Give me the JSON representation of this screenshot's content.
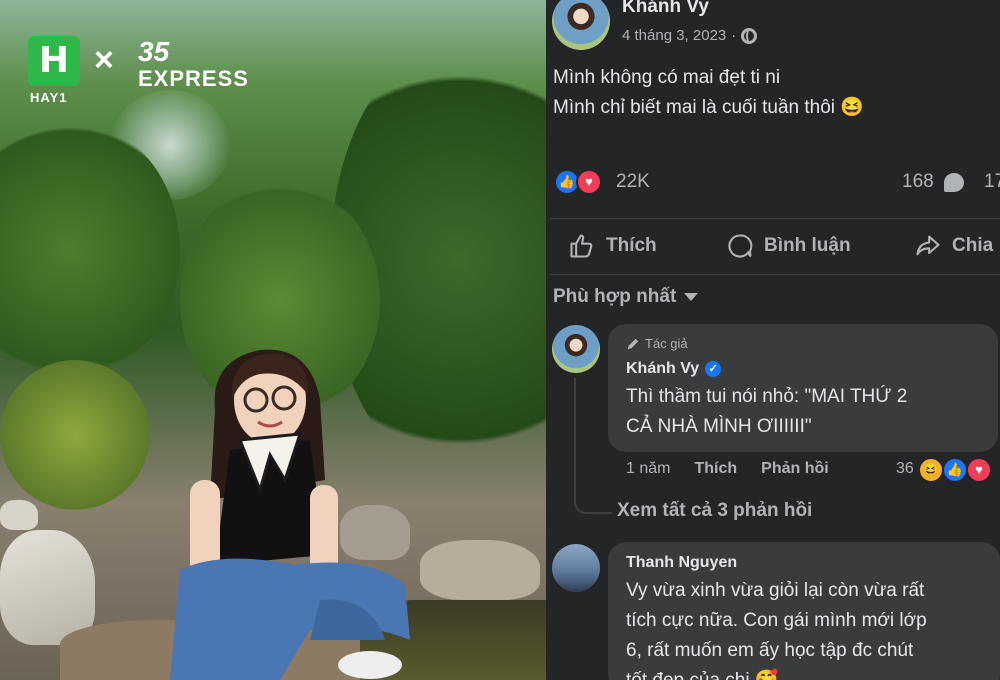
{
  "brand": {
    "logo_letter": "H",
    "logo_caption": "HAY1",
    "separator": "×",
    "partner_number": "35",
    "partner_word": "EXPRESS"
  },
  "post": {
    "author": "Khánh Vy",
    "date": "4 tháng 3, 2023",
    "separator_dot": "·",
    "lines": [
      "Mình không có mai đẹt ti ni",
      "Mình chỉ biết mai là cuối tuần thôi 😆"
    ],
    "reaction_count": "22K",
    "comment_count": "168",
    "share_count_partial": "17"
  },
  "actions": {
    "like": "Thích",
    "comment": "Bình luận",
    "share": "Chia"
  },
  "sort_label": "Phù hợp nhất",
  "comments": [
    {
      "badge": "Tác giả",
      "name": "Khánh Vy",
      "lines": [
        "Thì thầm tui nói nhỏ: \"MAI THỨ 2",
        "CẢ NHÀ MÌNH ƠIIIIII\""
      ],
      "time": "1 năm",
      "like_label": "Thích",
      "reply_label": "Phản hồi",
      "reaction_count": "36"
    },
    {
      "name": "Thanh Nguyen",
      "lines": [
        "Vy vừa xinh vừa giỏi lại còn vừa rất",
        "tích cực nữa. Con gái mình mới lớp",
        "6, rất muốn em ấy học tập đc chút",
        "tốt đẹp của chị 🥰"
      ]
    }
  ],
  "view_replies": "Xem tất cả 3 phản hồi",
  "colors": {
    "panel_bg": "#242526",
    "bubble_bg": "#3a3b3c",
    "text_primary": "#e4e6eb",
    "text_secondary": "#b0b3b8",
    "like_blue": "#1877f2",
    "love_red": "#f33e58",
    "brand_green": "#2fb84a"
  }
}
